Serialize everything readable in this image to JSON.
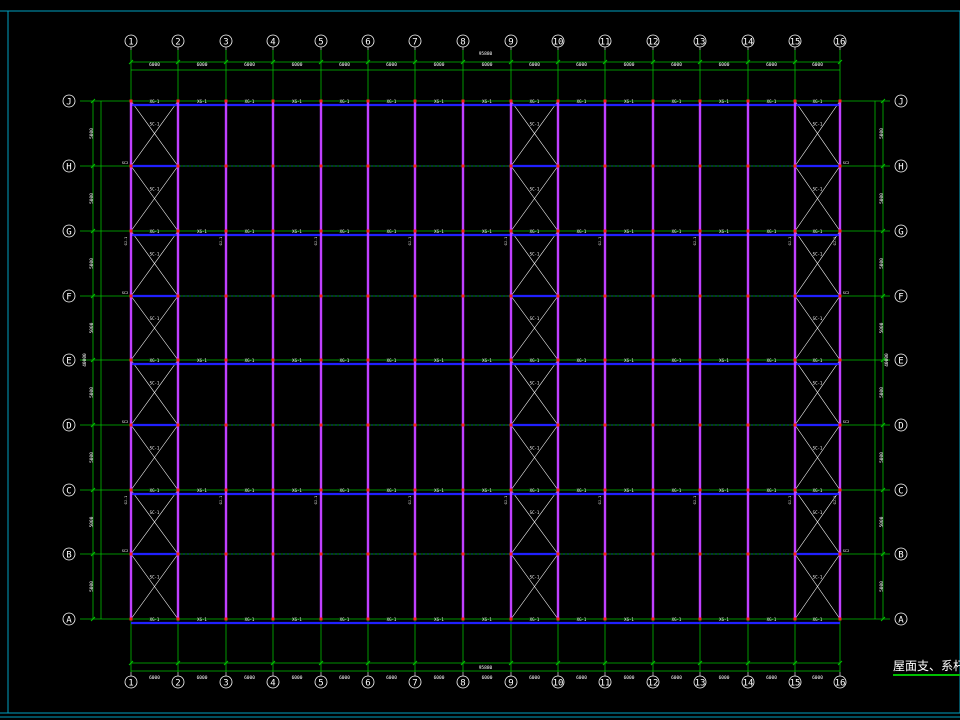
{
  "drawing": {
    "title": "屋面支、系杆布置图",
    "overall_dim": "95880",
    "overall_dim_side": "40000",
    "col_axes": [
      "1",
      "2",
      "3",
      "4",
      "5",
      "6",
      "7",
      "8",
      "9",
      "10",
      "11",
      "12",
      "13",
      "14",
      "15",
      "16"
    ],
    "row_axes": [
      "J",
      "H",
      "G",
      "F",
      "E",
      "D",
      "C",
      "B",
      "A"
    ],
    "bay_dims": [
      "6000",
      "6000",
      "6000",
      "6000",
      "6000",
      "6000",
      "6000",
      "6000",
      "6000",
      "6000",
      "6000",
      "6000",
      "6000",
      "6000",
      "6000"
    ],
    "row_dims": [
      "5000",
      "5000",
      "5000",
      "5000",
      "5000",
      "5000",
      "5000",
      "5000"
    ],
    "tie_label": "XG-1",
    "brace_label": "SC-1",
    "col_label": "GJ-1",
    "end_label": "SC2",
    "braced_bays": [
      0,
      8,
      14
    ],
    "cross_braced_rows": [
      0,
      1,
      2,
      3,
      4,
      5,
      6,
      7
    ]
  },
  "colors": {
    "background": "#000000",
    "frame": "#00a0c0",
    "grid": "#00c000",
    "rafter": "#c040ff",
    "tie": "#2020ff",
    "brace": "#ffffff",
    "text": "#ffffff",
    "bubble": "#ffffff",
    "node": "#ff2020"
  }
}
